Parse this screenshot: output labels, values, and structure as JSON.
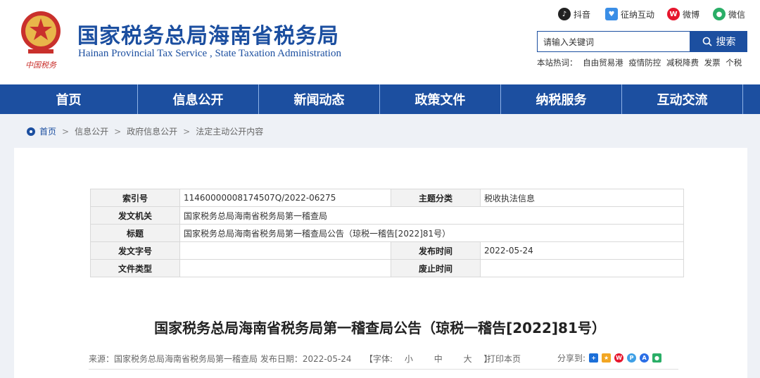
{
  "header": {
    "title_cn": "国家税务总局海南省税务局",
    "title_en": "Hainan Provincial Tax Service , State Taxation Administration",
    "emblem_text": "中国税务",
    "social": [
      {
        "label": "抖音",
        "icon": "douyin-icon",
        "color": "#222222"
      },
      {
        "label": "征纳互动",
        "icon": "interaction-icon",
        "color": "#3a8ee6"
      },
      {
        "label": "微博",
        "icon": "weibo-icon",
        "color": "#e6162d"
      },
      {
        "label": "微信",
        "icon": "wechat-icon",
        "color": "#2aae67"
      }
    ],
    "search": {
      "value": "请输入关键词",
      "button": "搜索"
    },
    "hot": {
      "label": "本站热词：",
      "words": [
        "自由贸易港",
        "疫情防控",
        "减税降费",
        "发票",
        "个税"
      ]
    }
  },
  "nav": [
    "首页",
    "信息公开",
    "新闻动态",
    "政策文件",
    "纳税服务",
    "互动交流"
  ],
  "breadcrumb": [
    "首页",
    "信息公开",
    "政府信息公开",
    "法定主动公开内容"
  ],
  "meta": {
    "index_label": "索引号",
    "index_value": "11460000008174507Q/2022-06275",
    "topic_label": "主题分类",
    "topic_value": "税收执法信息",
    "issuer_label": "发文机关",
    "issuer_value": "国家税务总局海南省税务局第一稽查局",
    "title_label": "标题",
    "title_value": "国家税务总局海南省税务局第一稽查局公告（琼税一稽告[2022]81号）",
    "docno_label": "发文字号",
    "docno_value": "",
    "pubdate_label": "发布时间",
    "pubdate_value": "2022-05-24",
    "type_label": "文件类型",
    "type_value": "",
    "expire_label": "废止时间",
    "expire_value": ""
  },
  "article": {
    "title": "国家税务总局海南省税务局第一稽查局公告（琼税一稽告[2022]81号）",
    "source": "来源：国家税务总局海南省税务局第一稽查局   发布日期：2022-05-24",
    "font_label_open": "【字体:",
    "font_small": "小",
    "font_medium": "中",
    "font_large": "大",
    "font_label_close": "】",
    "print": "打印本页",
    "share_label": "分享到:"
  },
  "colors": {
    "brand": "#1c4fa0",
    "nav_divider": "#8fb2e6",
    "background": "#eef1f6"
  }
}
